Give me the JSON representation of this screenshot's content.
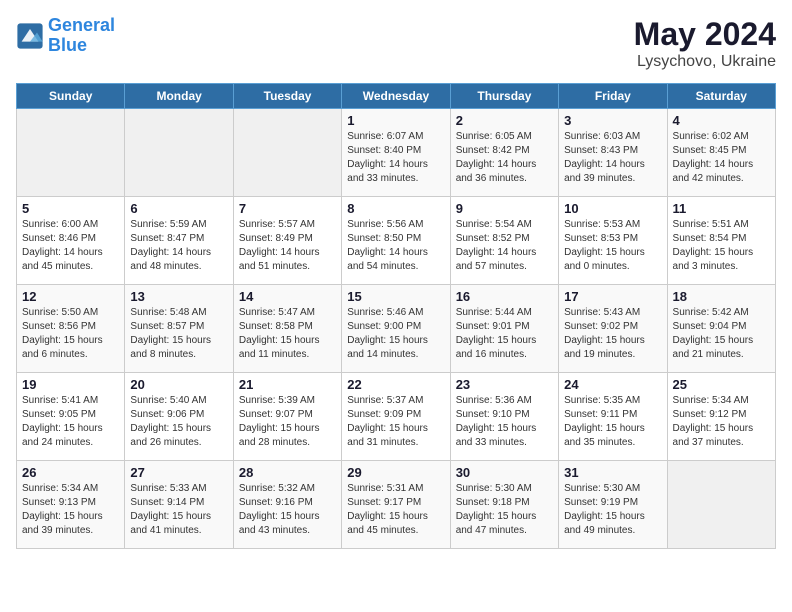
{
  "header": {
    "logo_line1": "General",
    "logo_line2": "Blue",
    "month": "May 2024",
    "location": "Lysychovo, Ukraine"
  },
  "weekdays": [
    "Sunday",
    "Monday",
    "Tuesday",
    "Wednesday",
    "Thursday",
    "Friday",
    "Saturday"
  ],
  "weeks": [
    [
      {
        "day": "",
        "empty": true
      },
      {
        "day": "",
        "empty": true
      },
      {
        "day": "",
        "empty": true
      },
      {
        "day": "1",
        "sunrise": "6:07 AM",
        "sunset": "8:40 PM",
        "daylight": "14 hours and 33 minutes."
      },
      {
        "day": "2",
        "sunrise": "6:05 AM",
        "sunset": "8:42 PM",
        "daylight": "14 hours and 36 minutes."
      },
      {
        "day": "3",
        "sunrise": "6:03 AM",
        "sunset": "8:43 PM",
        "daylight": "14 hours and 39 minutes."
      },
      {
        "day": "4",
        "sunrise": "6:02 AM",
        "sunset": "8:45 PM",
        "daylight": "14 hours and 42 minutes."
      }
    ],
    [
      {
        "day": "5",
        "sunrise": "6:00 AM",
        "sunset": "8:46 PM",
        "daylight": "14 hours and 45 minutes."
      },
      {
        "day": "6",
        "sunrise": "5:59 AM",
        "sunset": "8:47 PM",
        "daylight": "14 hours and 48 minutes."
      },
      {
        "day": "7",
        "sunrise": "5:57 AM",
        "sunset": "8:49 PM",
        "daylight": "14 hours and 51 minutes."
      },
      {
        "day": "8",
        "sunrise": "5:56 AM",
        "sunset": "8:50 PM",
        "daylight": "14 hours and 54 minutes."
      },
      {
        "day": "9",
        "sunrise": "5:54 AM",
        "sunset": "8:52 PM",
        "daylight": "14 hours and 57 minutes."
      },
      {
        "day": "10",
        "sunrise": "5:53 AM",
        "sunset": "8:53 PM",
        "daylight": "15 hours and 0 minutes."
      },
      {
        "day": "11",
        "sunrise": "5:51 AM",
        "sunset": "8:54 PM",
        "daylight": "15 hours and 3 minutes."
      }
    ],
    [
      {
        "day": "12",
        "sunrise": "5:50 AM",
        "sunset": "8:56 PM",
        "daylight": "15 hours and 6 minutes."
      },
      {
        "day": "13",
        "sunrise": "5:48 AM",
        "sunset": "8:57 PM",
        "daylight": "15 hours and 8 minutes."
      },
      {
        "day": "14",
        "sunrise": "5:47 AM",
        "sunset": "8:58 PM",
        "daylight": "15 hours and 11 minutes."
      },
      {
        "day": "15",
        "sunrise": "5:46 AM",
        "sunset": "9:00 PM",
        "daylight": "15 hours and 14 minutes."
      },
      {
        "day": "16",
        "sunrise": "5:44 AM",
        "sunset": "9:01 PM",
        "daylight": "15 hours and 16 minutes."
      },
      {
        "day": "17",
        "sunrise": "5:43 AM",
        "sunset": "9:02 PM",
        "daylight": "15 hours and 19 minutes."
      },
      {
        "day": "18",
        "sunrise": "5:42 AM",
        "sunset": "9:04 PM",
        "daylight": "15 hours and 21 minutes."
      }
    ],
    [
      {
        "day": "19",
        "sunrise": "5:41 AM",
        "sunset": "9:05 PM",
        "daylight": "15 hours and 24 minutes."
      },
      {
        "day": "20",
        "sunrise": "5:40 AM",
        "sunset": "9:06 PM",
        "daylight": "15 hours and 26 minutes."
      },
      {
        "day": "21",
        "sunrise": "5:39 AM",
        "sunset": "9:07 PM",
        "daylight": "15 hours and 28 minutes."
      },
      {
        "day": "22",
        "sunrise": "5:37 AM",
        "sunset": "9:09 PM",
        "daylight": "15 hours and 31 minutes."
      },
      {
        "day": "23",
        "sunrise": "5:36 AM",
        "sunset": "9:10 PM",
        "daylight": "15 hours and 33 minutes."
      },
      {
        "day": "24",
        "sunrise": "5:35 AM",
        "sunset": "9:11 PM",
        "daylight": "15 hours and 35 minutes."
      },
      {
        "day": "25",
        "sunrise": "5:34 AM",
        "sunset": "9:12 PM",
        "daylight": "15 hours and 37 minutes."
      }
    ],
    [
      {
        "day": "26",
        "sunrise": "5:34 AM",
        "sunset": "9:13 PM",
        "daylight": "15 hours and 39 minutes."
      },
      {
        "day": "27",
        "sunrise": "5:33 AM",
        "sunset": "9:14 PM",
        "daylight": "15 hours and 41 minutes."
      },
      {
        "day": "28",
        "sunrise": "5:32 AM",
        "sunset": "9:16 PM",
        "daylight": "15 hours and 43 minutes."
      },
      {
        "day": "29",
        "sunrise": "5:31 AM",
        "sunset": "9:17 PM",
        "daylight": "15 hours and 45 minutes."
      },
      {
        "day": "30",
        "sunrise": "5:30 AM",
        "sunset": "9:18 PM",
        "daylight": "15 hours and 47 minutes."
      },
      {
        "day": "31",
        "sunrise": "5:30 AM",
        "sunset": "9:19 PM",
        "daylight": "15 hours and 49 minutes."
      },
      {
        "day": "",
        "empty": true
      }
    ]
  ]
}
